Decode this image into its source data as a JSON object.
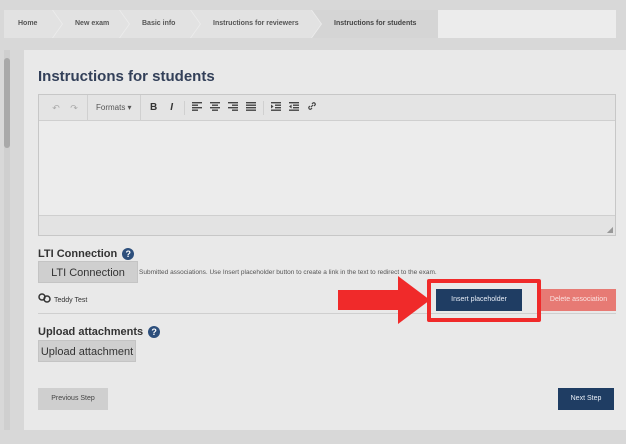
{
  "breadcrumb": [
    "Home",
    "New exam",
    "Basic info",
    "Instructions for reviewers",
    "Instructions for students"
  ],
  "page_title": "Instructions for students",
  "toolbar": {
    "undo_icon": "undo-icon",
    "redo_icon": "redo-icon",
    "formats_label": "Formats ▾",
    "bold_label": "B",
    "italic_label": "I",
    "link_icon": "link-icon"
  },
  "lti": {
    "title": "LTI Connection",
    "button_label": "LTI Connection",
    "note": "Submitted associations. Use Insert placeholder button to create a link in the text to redirect to the exam.",
    "association_name": "Teddy Test",
    "insert_label": "Insert placeholder",
    "delete_label": "Delete association"
  },
  "upload": {
    "title": "Upload attachments",
    "button_label": "Upload attachment"
  },
  "footer": {
    "prev_label": "Previous Step",
    "next_label": "Next Step"
  },
  "colors": {
    "primary": "#1f3d63",
    "danger": "#e77a74",
    "highlight": "#f02a2a",
    "title": "#334059"
  }
}
